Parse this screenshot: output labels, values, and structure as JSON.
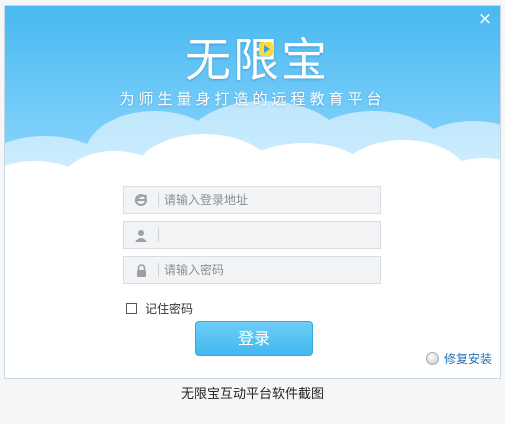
{
  "window": {
    "close_glyph": "×",
    "logo_text": "无限宝",
    "tagline": "为师生量身打造的远程教育平台"
  },
  "form": {
    "address": {
      "placeholder": "请输入登录地址",
      "value": ""
    },
    "username": {
      "placeholder": "",
      "value": ""
    },
    "password": {
      "placeholder": "请输入密码",
      "value": ""
    },
    "remember_label": "记住密码",
    "remember_checked": false,
    "login_label": "登录",
    "repair_label": "修复安装"
  },
  "caption": "无限宝互动平台软件截图",
  "colors": {
    "sky_top": "#48b9f0",
    "sky_bottom": "#a9e0fd",
    "button": "#43b8ef",
    "link": "#2372b8"
  },
  "icons": [
    "close-icon",
    "ie-icon",
    "user-icon",
    "lock-icon",
    "checkbox-icon",
    "repair-icon"
  ]
}
